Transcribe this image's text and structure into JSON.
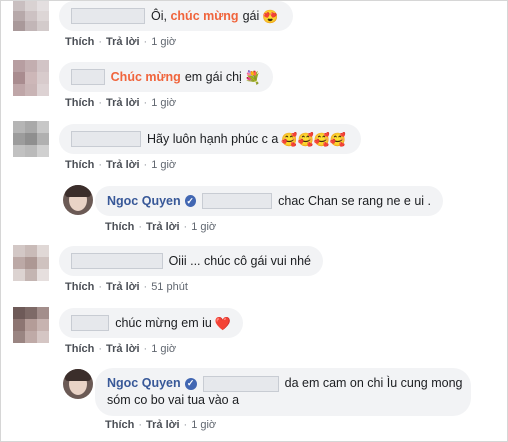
{
  "actions": {
    "like": "Thích",
    "reply": "Trả lời",
    "separator": "·"
  },
  "comments": [
    {
      "accent": "chúc mừng",
      "text_before": "Ôi,",
      "text_after": "gái",
      "emoji": "😍",
      "time": "1 giờ"
    },
    {
      "accent": "Chúc mừng",
      "text_after": "em gái chị",
      "emoji": "💐",
      "time": "1 giờ"
    },
    {
      "text": "Hãy luôn hạnh phúc c a",
      "emoji": "🥰🥰🥰🥰",
      "time": "1 giờ"
    },
    {
      "author": "Ngoc Quyen",
      "text": "chac Chan se rang ne e ui .",
      "time": "1 giờ"
    },
    {
      "text": "Oiii ... chúc cô gái vui nhé",
      "time": "51 phút"
    },
    {
      "text": "chúc mừng em iu",
      "emoji": "❤️",
      "time": "1 giờ"
    },
    {
      "author": "Ngoc Quyen",
      "text_line1": "da em cam on chi Ìu cung mong",
      "text_line2": "sóm co bo vai tua vào a",
      "time": "1 giờ"
    }
  ],
  "colors": {
    "accent": "#f0643c",
    "author": "#385898",
    "bubble": "#f2f3f5",
    "verified": "#4267b2"
  }
}
